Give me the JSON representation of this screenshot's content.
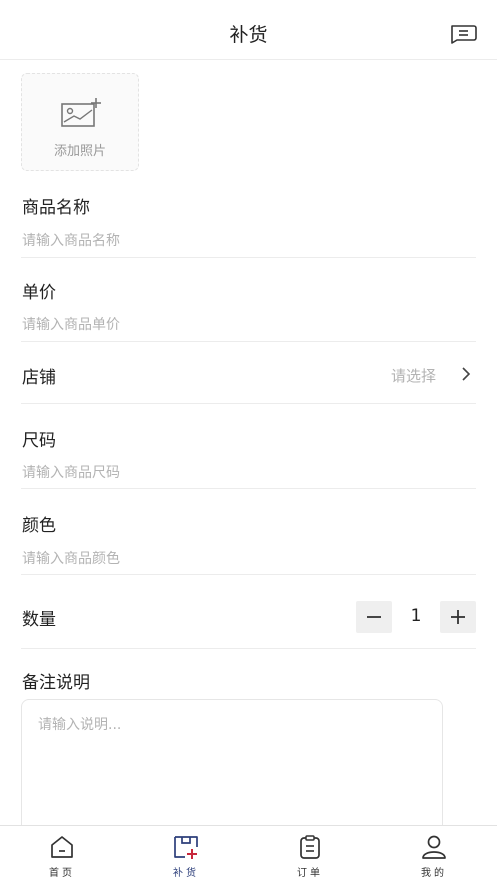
{
  "header": {
    "title": "补货",
    "message_icon": "message-icon"
  },
  "upload": {
    "label": "添加照片",
    "icon": "add-image-icon"
  },
  "fields": {
    "name": {
      "label": "商品名称",
      "placeholder": "请输入商品名称"
    },
    "price": {
      "label": "单价",
      "placeholder": "请输入商品单价"
    },
    "size": {
      "label": "尺码",
      "placeholder": "请输入商品尺码"
    },
    "color": {
      "label": "颜色",
      "placeholder": "请输入商品颜色"
    }
  },
  "store": {
    "label": "店铺",
    "value": "请选择",
    "icon": "chevron-right-icon"
  },
  "quantity": {
    "label": "数量",
    "value": "1",
    "minus": "−",
    "plus": "+"
  },
  "note": {
    "label": "备注说明",
    "placeholder": "请输入说明..."
  },
  "tabbar": {
    "items": [
      {
        "label": "首页",
        "icon": "home-icon"
      },
      {
        "label": "补货",
        "icon": "restock-icon"
      },
      {
        "label": "订单",
        "icon": "order-icon"
      },
      {
        "label": "我的",
        "icon": "user-icon"
      }
    ],
    "active_color": "#c8283c"
  }
}
